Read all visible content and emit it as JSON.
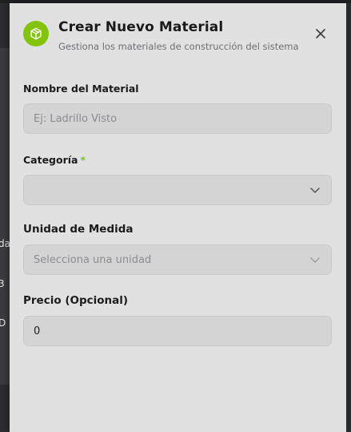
{
  "modal": {
    "title": "Crear Nuevo Material",
    "subtitle": "Gestiona los materiales de construcción del sistema",
    "icon": "package-icon",
    "accent_color": "#84c408"
  },
  "background_fragments": [
    "da",
    "3",
    "D"
  ],
  "form": {
    "name": {
      "label": "Nombre del Material",
      "placeholder": "Ej: Ladrillo Visto",
      "value": ""
    },
    "category": {
      "label": "Categoría",
      "required_mark": "*",
      "value": ""
    },
    "unit": {
      "label": "Unidad de Medida",
      "placeholder": "Selecciona una unidad"
    },
    "price": {
      "label": "Precio (Opcional)",
      "value": "0"
    }
  }
}
